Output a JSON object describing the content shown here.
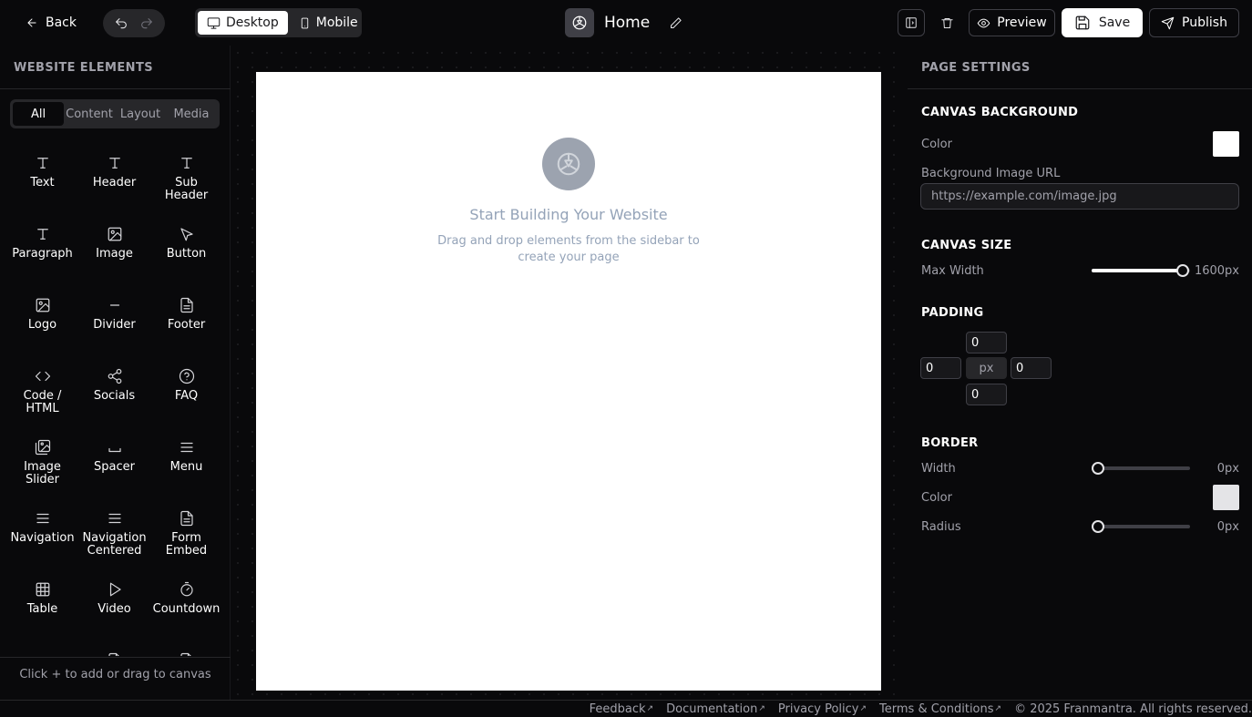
{
  "topbar": {
    "back_label": "Back",
    "device_desktop": "Desktop",
    "device_mobile": "Mobile",
    "active_device": "Desktop",
    "page_title": "Home",
    "preview_label": "Preview",
    "save_label": "Save",
    "publish_label": "Publish"
  },
  "left_panel": {
    "heading": "WEBSITE ELEMENTS",
    "filters": [
      "All",
      "Content",
      "Layout",
      "Media"
    ],
    "active_filter": "All",
    "elements": [
      {
        "label": "Text",
        "icon": "text-icon"
      },
      {
        "label": "Header",
        "icon": "text-icon"
      },
      {
        "label": "Sub Header",
        "icon": "text-icon"
      },
      {
        "label": "Paragraph",
        "icon": "text-icon"
      },
      {
        "label": "Image",
        "icon": "image-icon"
      },
      {
        "label": "Button",
        "icon": "cursor-icon"
      },
      {
        "label": "Logo",
        "icon": "image-icon"
      },
      {
        "label": "Divider",
        "icon": "minus-icon"
      },
      {
        "label": "Footer",
        "icon": "file-icon"
      },
      {
        "label": "Code / HTML",
        "icon": "code-icon"
      },
      {
        "label": "Socials",
        "icon": "share-icon"
      },
      {
        "label": "FAQ",
        "icon": "help-circle-icon"
      },
      {
        "label": "Image Slider",
        "icon": "images-icon"
      },
      {
        "label": "Spacer",
        "icon": "spacer-icon"
      },
      {
        "label": "Menu",
        "icon": "menu-icon"
      },
      {
        "label": "Navigation",
        "icon": "menu-icon"
      },
      {
        "label": "Navigation Centered",
        "icon": "menu-icon"
      },
      {
        "label": "Form Embed",
        "icon": "file-icon"
      },
      {
        "label": "Table",
        "icon": "table-icon"
      },
      {
        "label": "Video",
        "icon": "play-icon"
      },
      {
        "label": "Countdown",
        "icon": "timer-icon"
      }
    ],
    "hint": "Click + to add or drag to canvas"
  },
  "canvas": {
    "empty_title": "Start Building Your Website",
    "empty_subtitle": "Drag and drop elements from the sidebar to create your page",
    "background": "#ffffff"
  },
  "right_panel": {
    "heading": "PAGE SETTINGS",
    "canvas_background": {
      "title": "CANVAS BACKGROUND",
      "color_label": "Color",
      "color_value": "#ffffff",
      "image_url_label": "Background Image URL",
      "image_url_placeholder": "https://example.com/image.jpg"
    },
    "canvas_size": {
      "title": "CANVAS SIZE",
      "max_width_label": "Max Width",
      "max_width_value": "1600px",
      "max_width_fraction": 0.93
    },
    "padding": {
      "title": "PADDING",
      "top": "0",
      "left": "0",
      "right": "0",
      "bottom": "0",
      "unit": "px"
    },
    "border": {
      "title": "BORDER",
      "width_label": "Width",
      "width_value": "0px",
      "width_fraction": 0,
      "color_label": "Color",
      "color_value": "#e4e4e7",
      "radius_label": "Radius",
      "radius_value": "0px",
      "radius_fraction": 0
    }
  },
  "footer": {
    "links": [
      "Feedback",
      "Documentation",
      "Privacy Policy",
      "Terms & Conditions"
    ],
    "copyright": "© 2025 Franmantra. All rights reserved."
  }
}
